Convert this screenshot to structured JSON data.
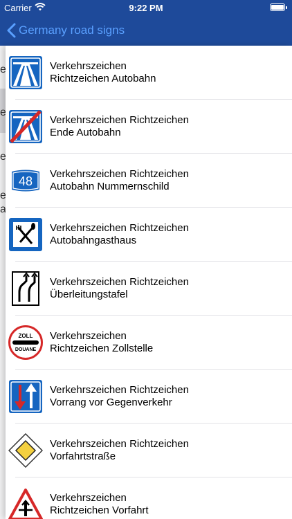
{
  "status_bar": {
    "carrier": "Carrier",
    "time": "9:22 PM"
  },
  "nav": {
    "back_label": "Germany road signs"
  },
  "underlay_fragments": [
    "e",
    "e",
    "e",
    "e",
    "a"
  ],
  "colors": {
    "bar_background": "#1e4a9a",
    "back_tint": "#5aa0ff",
    "sign_blue": "#1565c0",
    "sign_red": "#d62828",
    "sign_yellow": "#f4d03f"
  },
  "items": [
    {
      "icon": "autobahn-sign-icon",
      "title": "Verkehrszeichen\nRichtzeichen Autobahn"
    },
    {
      "icon": "end-autobahn-sign-icon",
      "title": "Verkehrszeichen Richtzeichen\nEnde Autobahn"
    },
    {
      "icon": "autobahn-number-sign-icon",
      "icon_text": "48",
      "title": "Verkehrszeichen Richtzeichen\nAutobahn Nummernschild"
    },
    {
      "icon": "autobahn-restaurant-sign-icon",
      "title": "Verkehrszeichen Richtzeichen\nAutobahngasthaus"
    },
    {
      "icon": "transition-board-sign-icon",
      "title": "Verkehrszeichen Richtzeichen\nÜberleitungstafel"
    },
    {
      "icon": "customs-sign-icon",
      "icon_text_top": "ZOLL",
      "icon_text_bottom": "DOUANE",
      "title": "Verkehrszeichen\nRichtzeichen Zollstelle"
    },
    {
      "icon": "priority-over-oncoming-sign-icon",
      "title": "Verkehrszeichen Richtzeichen\nVorrang vor Gegenverkehr"
    },
    {
      "icon": "priority-road-sign-icon",
      "title": "Verkehrszeichen Richtzeichen\nVorfahrtstraße"
    },
    {
      "icon": "right-of-way-sign-icon",
      "title": "Verkehrszeichen\nRichtzeichen Vorfahrt"
    }
  ]
}
